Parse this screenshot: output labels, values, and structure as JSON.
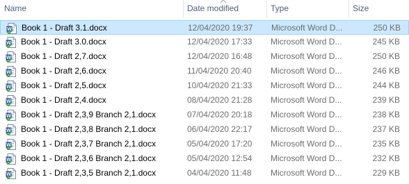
{
  "columns": {
    "name": "Name",
    "date_modified": "Date modified",
    "type": "Type",
    "size": "Size"
  },
  "files": [
    {
      "name": "Book 1 - Draft 3.1.docx",
      "date": "12/04/2020 19:37",
      "type": "Microsoft Word D...",
      "size": "250 KB",
      "selected": true
    },
    {
      "name": "Book 1 - Draft 3.0.docx",
      "date": "12/04/2020 17:33",
      "type": "Microsoft Word D...",
      "size": "245 KB"
    },
    {
      "name": "Book 1 - Draft 2,7.docx",
      "date": "12/04/2020 16:48",
      "type": "Microsoft Word D...",
      "size": "250 KB"
    },
    {
      "name": "Book 1 - Draft 2,6.docx",
      "date": "11/04/2020 20:40",
      "type": "Microsoft Word D...",
      "size": "246 KB"
    },
    {
      "name": "Book 1 - Draft 2,5.docx",
      "date": "10/04/2020 21:33",
      "type": "Microsoft Word D...",
      "size": "244 KB"
    },
    {
      "name": "Book 1 - Draft 2,4.docx",
      "date": "08/04/2020 21:28",
      "type": "Microsoft Word D...",
      "size": "239 KB"
    },
    {
      "name": "Book 1 - Draft 2,3,9 Branch 2,1.docx",
      "date": "07/04/2020 20:18",
      "type": "Microsoft Word D...",
      "size": "238 KB"
    },
    {
      "name": "Book 1 - Draft 2,3,8 Branch 2,1.docx",
      "date": "06/04/2020 22:17",
      "type": "Microsoft Word D...",
      "size": "237 KB"
    },
    {
      "name": "Book 1 - Draft 2,3,7 Branch 2,1.docx",
      "date": "05/04/2020 17:20",
      "type": "Microsoft Word D...",
      "size": "235 KB"
    },
    {
      "name": "Book 1 - Draft 2,3,6 Branch 2,1.docx",
      "date": "05/04/2020 12:54",
      "type": "Microsoft Word D...",
      "size": "232 KB"
    },
    {
      "name": "Book 1 - Draft 2,3,5 Branch 2,1.docx",
      "date": "04/04/2020 11:48",
      "type": "Microsoft Word D...",
      "size": "229 KB"
    }
  ],
  "icon": "word-document-icon",
  "colors": {
    "selection_bg": "#cce8ff",
    "selection_border": "#99d1ff",
    "header_text": "#4c607a",
    "detail_text": "#6d6d6d"
  }
}
